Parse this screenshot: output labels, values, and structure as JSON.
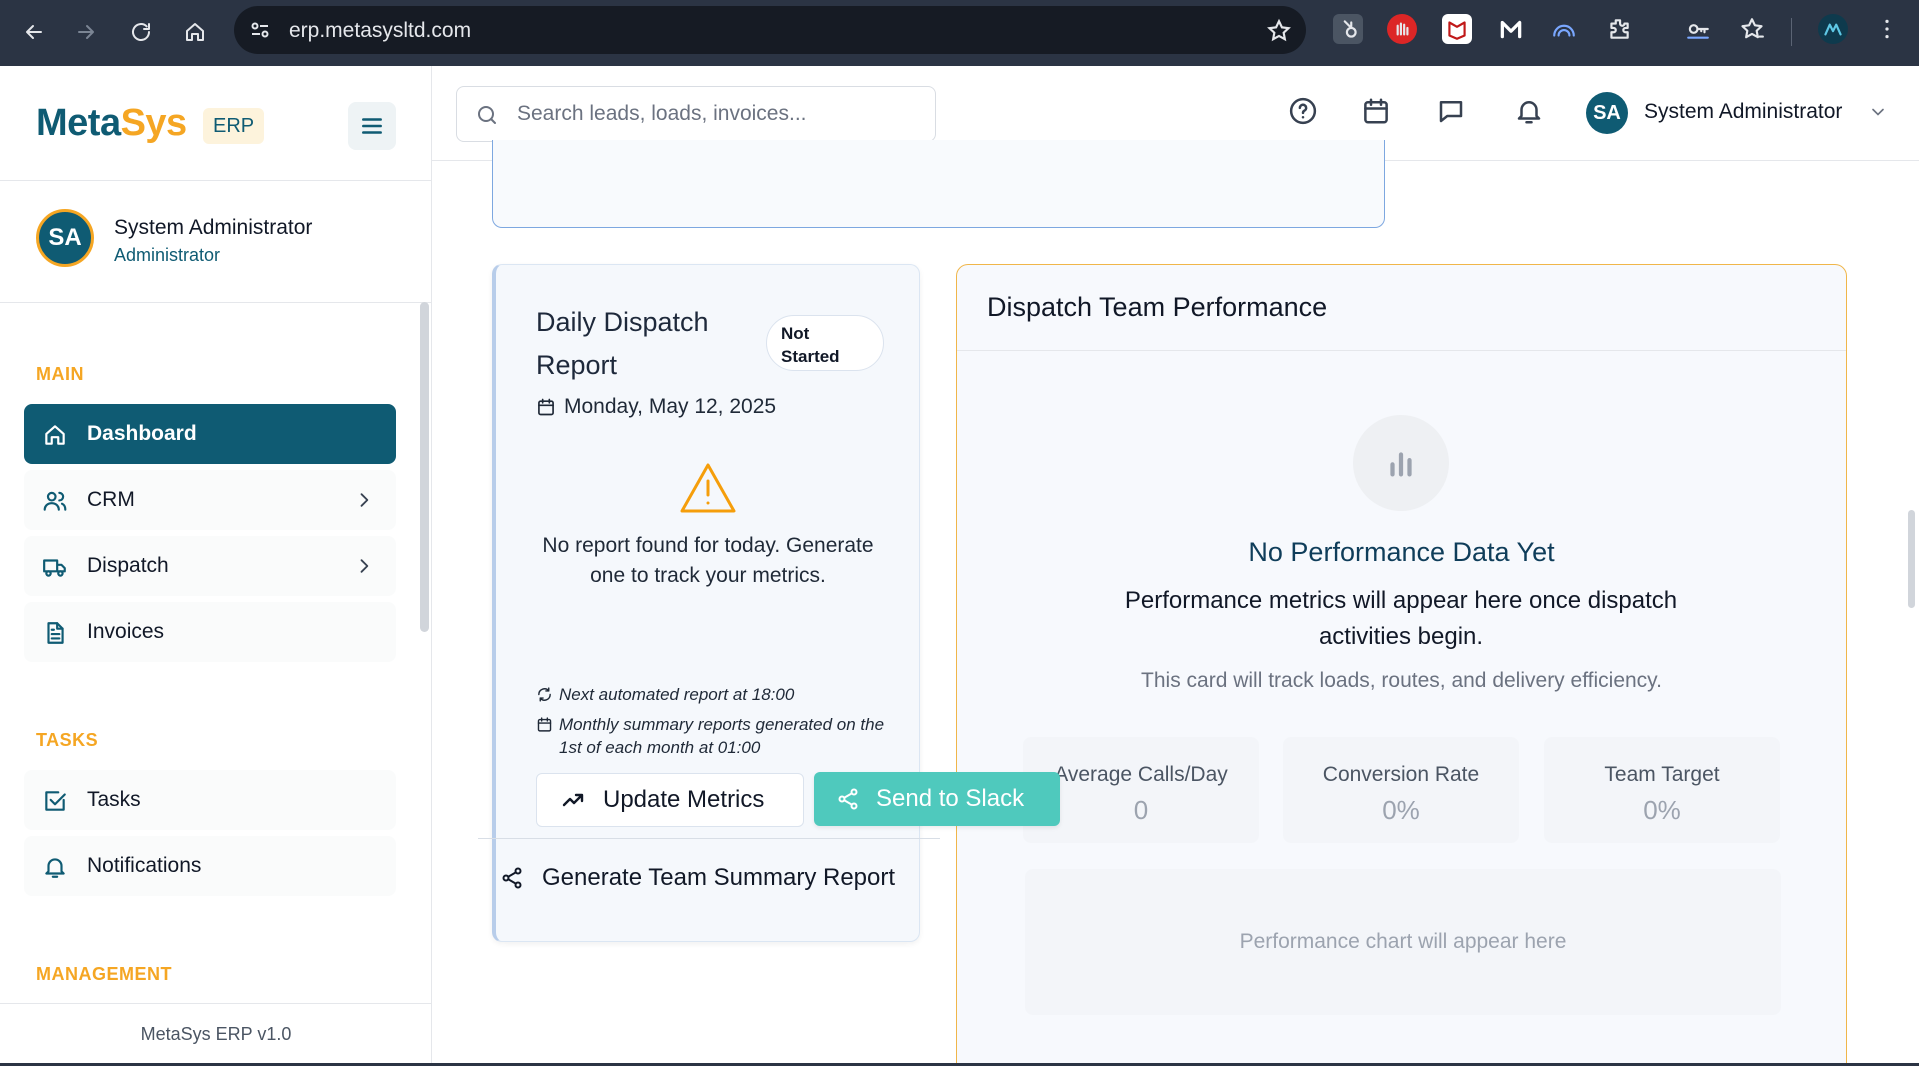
{
  "browser": {
    "url": "erp.metasysltd.com"
  },
  "sidebar": {
    "brand_meta": "Meta",
    "brand_sys": "Sys",
    "brand_badge": "ERP",
    "user": {
      "initials": "SA",
      "name": "System Administrator",
      "role": "Administrator"
    },
    "sections": {
      "main": "MAIN",
      "tasks": "TASKS",
      "management": "MANAGEMENT"
    },
    "items": [
      {
        "label": "Dashboard",
        "icon": "home-icon",
        "active": true
      },
      {
        "label": "CRM",
        "icon": "users-icon",
        "has_children": true
      },
      {
        "label": "Dispatch",
        "icon": "truck-icon",
        "has_children": true
      },
      {
        "label": "Invoices",
        "icon": "document-icon"
      },
      {
        "label": "Tasks",
        "icon": "checkbox-icon"
      },
      {
        "label": "Notifications",
        "icon": "bell-icon"
      }
    ],
    "footer": "MetaSys ERP v1.0"
  },
  "header": {
    "search_placeholder": "Search leads, loads, invoices...",
    "user_initials": "SA",
    "user_name": "System Administrator"
  },
  "daily_report": {
    "title": "Daily Dispatch Report",
    "status": "Not Started",
    "date": "Monday, May 12, 2025",
    "empty_message": "No report found for today. Generate one to track your metrics.",
    "note_next": "Next automated report at 18:00",
    "note_monthly": "Monthly summary reports generated on the 1st of each month at 01:00",
    "update_label": "Update Metrics",
    "slack_label": "Send to Slack",
    "summary_label": "Generate Team Summary Report"
  },
  "performance": {
    "title": "Dispatch Team Performance",
    "empty_title": "No Performance Data Yet",
    "empty_desc": "Performance metrics will appear here once dispatch activities begin.",
    "empty_sub": "This card will track loads, routes, and delivery efficiency.",
    "metrics": [
      {
        "label": "Average Calls/Day",
        "value": "0"
      },
      {
        "label": "Conversion Rate",
        "value": "0%"
      },
      {
        "label": "Team Target",
        "value": "0%"
      }
    ],
    "chart_placeholder": "Performance chart will appear here"
  },
  "colors": {
    "primary": "#0f5b73",
    "accent": "#f5a623",
    "slack": "#4fc9bd"
  }
}
